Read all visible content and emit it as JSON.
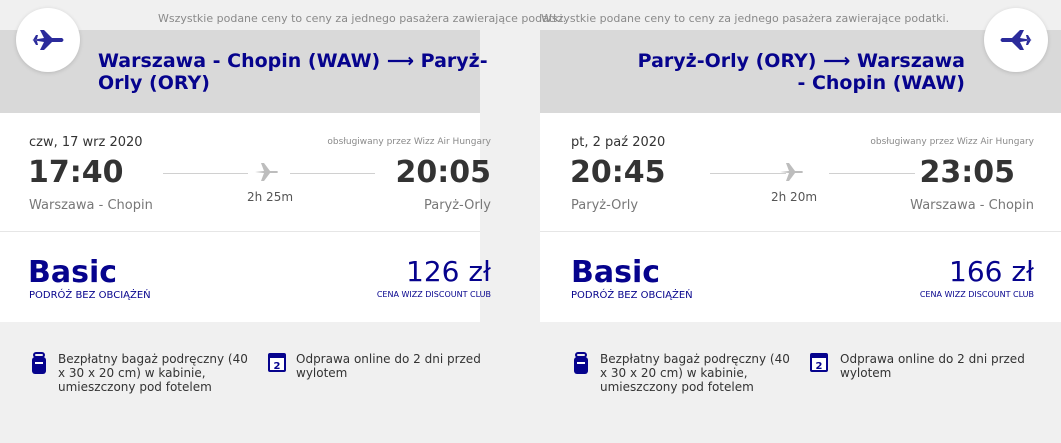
{
  "outbound": {
    "note": "Wszystkie podane ceny to ceny za jednego pasażera zawierające podatki.",
    "route": "Warszawa - Chopin (WAW) ⟶ Paryż-Orly (ORY)",
    "date": "czw, 17 wrz 2020",
    "operated_by": "obsługiwany przez Wizz Air Hungary",
    "dep_time": "17:40",
    "arr_time": "20:05",
    "dep_airport": "Warszawa - Chopin",
    "arr_airport": "Paryż-Orly",
    "duration": "2h 25m",
    "fare": "Basic",
    "fare_sub": "PODRÓŻ BEZ OBCIĄŻEŃ",
    "price": "126 zł",
    "price_sub": "CENA WIZZ DISCOUNT CLUB",
    "perk_bag": "Bezpłatny bagaż podręczny (40 x 30 x 20 cm) w kabinie, umieszczony pod fotelem",
    "perk_checkin": "Odprawa online do 2 dni przed wylotem",
    "calendar_digit": "2"
  },
  "inbound": {
    "note": "Wszystkie podane ceny to ceny za jednego pasażera zawierające podatki.",
    "route": "Paryż-Orly (ORY) ⟶ Warszawa - Chopin (WAW)",
    "date": "pt, 2 paź 2020",
    "operated_by": "obsługiwany przez Wizz Air Hungary",
    "dep_time": "20:45",
    "arr_time": "23:05",
    "dep_airport": "Paryż-Orly",
    "arr_airport": "Warszawa - Chopin",
    "duration": "2h 20m",
    "fare": "Basic",
    "fare_sub": "PODRÓŻ BEZ OBCIĄŻEŃ",
    "price": "166 zł",
    "price_sub": "CENA WIZZ DISCOUNT CLUB",
    "perk_bag": "Bezpłatny bagaż podręczny (40 x 30 x 20 cm) w kabinie, umieszczony pod fotelem",
    "perk_checkin": "Odprawa online do 2 dni przed wylotem",
    "calendar_digit": "2"
  },
  "colors": {
    "brand": "#06038d",
    "header_bg": "#d9d9d9",
    "page_bg": "#f0f0f0"
  },
  "icons": [
    "plane-icon",
    "plane-small-icon",
    "bag-icon",
    "calendar-icon"
  ]
}
